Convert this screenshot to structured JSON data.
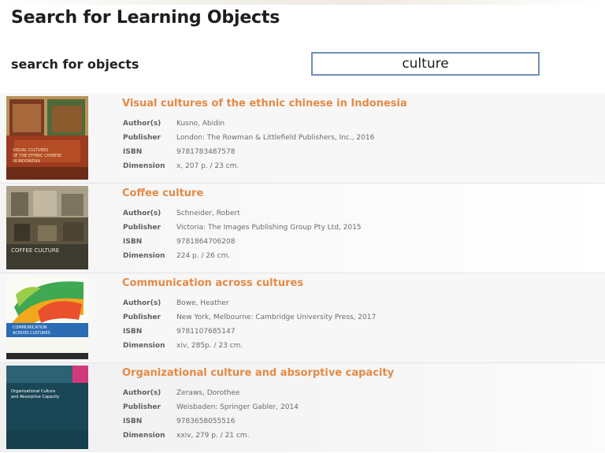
{
  "page": {
    "title": "Search for Learning Objects"
  },
  "search": {
    "label": "search for objects",
    "value": "culture"
  },
  "meta_labels": {
    "author": "Author(s)",
    "publisher": "Publisher",
    "isbn": "ISBN",
    "dimension": "Dimension"
  },
  "results": [
    {
      "title": "Visual cultures of the ethnic chinese in Indonesia",
      "author": "Kusno, Abidin",
      "publisher": "London: The Rowman & Littlefield Publishers, Inc., 2016",
      "isbn": "9781783487578",
      "dimension": "x, 207 p. / 23 cm.",
      "cover_text": [
        "VISUAL CULTURES",
        "OF THE ETHNIC CHINESE",
        "IN INDONESIA"
      ],
      "cover_colors": {
        "top": "#c9a15a",
        "mid": "#8c3b1e",
        "bottom": "#b88c55"
      }
    },
    {
      "title": "Coffee culture",
      "author": "Schneider, Robert",
      "publisher": "Victoria: The Images Publishing Group Pty Ltd, 2015",
      "isbn": "9781864706208",
      "dimension": "224 p. / 26 cm.",
      "cover_text": [
        "COFFEE CULTURE"
      ],
      "cover_colors": {
        "top": "#9a8f77",
        "mid": "#59503c",
        "bottom": "#3d3a30"
      }
    },
    {
      "title": "Communication across cultures",
      "author": "Bowe, Heather",
      "publisher": "New York, Melbourne: Cambridge University Press, 2017",
      "isbn": "9781107685147",
      "dimension": "xiv, 285p. / 23 cm.",
      "cover_text": [
        "COMMUNICATION",
        "ACROSS CULTURES"
      ],
      "cover_colors": {
        "top": "#3ea853",
        "mid": "#e9502c",
        "bottom": "#2b6cb3"
      }
    },
    {
      "title": "Organizational culture and absorptive capacity",
      "author": "Zeraws, Dorothee",
      "publisher": "Weisbaden: Springer Gabler, 2014",
      "isbn": "9783658055516",
      "dimension": "xxiv, 279 p. / 21 cm.",
      "cover_text": [
        "Organizational Culture",
        "and Absorptive Capacity"
      ],
      "cover_colors": {
        "top": "#d13a7a",
        "mid": "#1f4f5f",
        "bottom": "#16404d"
      }
    }
  ]
}
